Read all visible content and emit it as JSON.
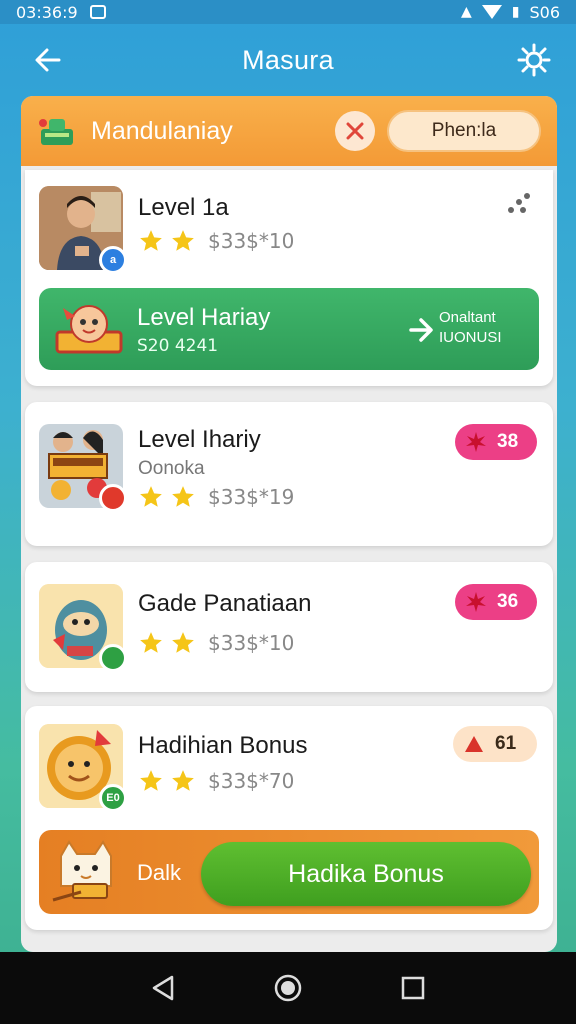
{
  "status_bar": {
    "time": "03:36:9",
    "right_text": "S06"
  },
  "header": {
    "title": "Masura"
  },
  "panel_header": {
    "title": "Mandulaniay",
    "pill_label": "Phen:la"
  },
  "items": [
    {
      "title": "Level 1a",
      "stars_text": "$33$*10",
      "thumb_badge": "a",
      "banner": {
        "title": "Level Hariay",
        "subtitle": "S20 4241",
        "right_line1": "Onaltant",
        "right_line2": "IUONUSI"
      }
    },
    {
      "title": "Level Ihariy",
      "subtitle": "Oonoka",
      "stars_text": "$33$*19",
      "badge_value": "38"
    },
    {
      "title": "Gade Panatiaan",
      "stars_text": "$33$*10",
      "badge_value": "36"
    },
    {
      "title": "Hadihian Bonus",
      "stars_text": "$33$*70",
      "badge_value": "61",
      "thumb_badge": "E0",
      "banner": {
        "left_text": "Dalk",
        "button_label": "Hadika Bonus"
      }
    }
  ],
  "colors": {
    "accent_orange": "#f39a36",
    "green": "#2e9d58",
    "pink_badge": "#ec3f86",
    "app_blue": "#2f9fd8"
  },
  "icons": [
    "back-arrow-icon",
    "gear-icon",
    "close-icon",
    "more-icon",
    "star-icon",
    "chevron-right-icon",
    "nav-back-icon",
    "nav-home-icon",
    "nav-recents-icon"
  ]
}
